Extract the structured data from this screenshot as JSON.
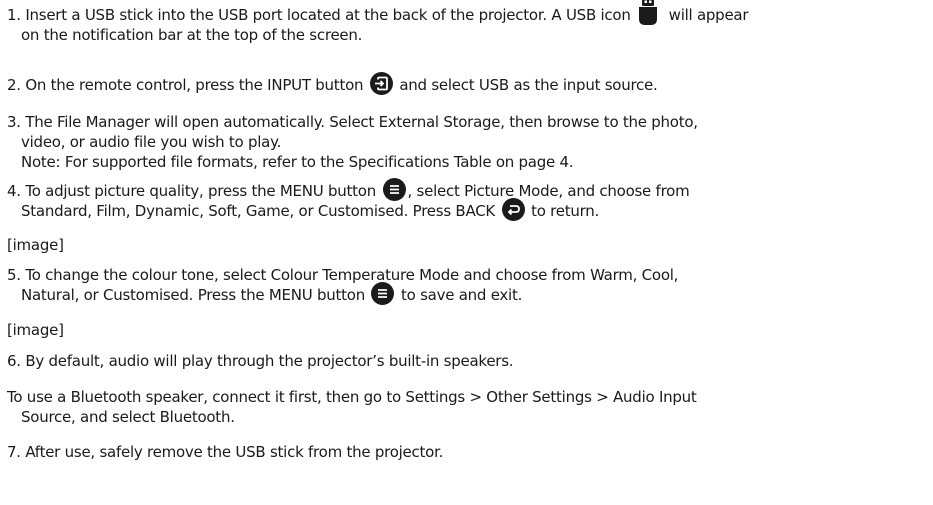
{
  "steps": {
    "s1": {
      "a": "1. Insert a USB stick into the USB port located at the back of the projector. A USB icon",
      "b": "will appear",
      "c": "on the notification bar at the top of the screen."
    },
    "s2": {
      "a": "2. On the remote control, press the INPUT button",
      "b": "and select USB as the input source."
    },
    "s3": {
      "a": "3. The File Manager will open automatically. Select External Storage, then browse to the photo,",
      "b": "video, or audio file you wish to play.",
      "c": "Note: For supported file formats, refer to the Specifications Table on page 4."
    },
    "s4": {
      "a": "4. To adjust picture quality, press the MENU button",
      "b": ", select Picture Mode, and choose from",
      "c": "Standard, Film, Dynamic, Soft, Game, or Customised. Press BACK",
      "d": "to return."
    },
    "img1": "[image]",
    "s5": {
      "a": "5. To change the colour tone, select Colour Temperature Mode and choose from Warm, Cool,",
      "b": "Natural, or Customised. Press the MENU button",
      "c": "to save and exit."
    },
    "img2": "[image]",
    "s6": "6. By default, audio will play through the projector’s built-in speakers.",
    "bt": {
      "a": "To use a Bluetooth speaker, connect it first, then go to Settings > Other Settings > Audio Input",
      "b": "Source, and select Bluetooth."
    },
    "s7": "7. After use, safely remove the USB stick from the projector."
  },
  "icons": [
    "usb-icon",
    "input-icon",
    "menu-icon",
    "back-icon"
  ],
  "colors": {
    "text": "#1a1a1a",
    "icon_bg": "#1b1b1b",
    "icon_fg": "#ffffff"
  }
}
